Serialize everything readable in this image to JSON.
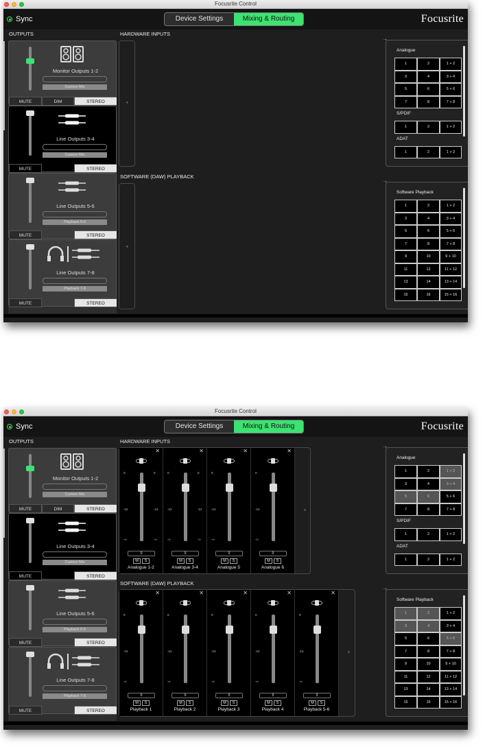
{
  "app": {
    "title": "Focusrite Control",
    "brand": "Focusrite"
  },
  "topbar": {
    "sync_label": "Sync",
    "tabs": [
      "Device Settings",
      "Mixing & Routing"
    ]
  },
  "sections": {
    "outputs": "OUTPUTS",
    "hardware_inputs": "HARDWARE INPUTS",
    "software_playback": "SOFTWARE (DAW) PLAYBACK"
  },
  "colors": {
    "accent": "#3ce370",
    "background": "#1e1e1e"
  },
  "outputs": [
    {
      "name": "Monitor Outputs 1-2",
      "source": "Custom Mix",
      "icon": "speakers-icon",
      "buttons": [
        "MUTE",
        "DIM",
        "STEREO"
      ]
    },
    {
      "name": "Line Outputs 3-4",
      "source": "Custom Mix",
      "icon": "line-cables-icon",
      "buttons": [
        "MUTE",
        "STEREO"
      ]
    },
    {
      "name": "Line Outputs 5-6",
      "source": "Playback 5-6",
      "icon": "line-cables-icon",
      "buttons": [
        "MUTE",
        "STEREO"
      ]
    },
    {
      "name": "Line Outputs 7-8",
      "source": "Playback 7-8",
      "icon": "headphones-icon",
      "buttons": [
        "MUTE",
        "STEREO"
      ]
    }
  ],
  "input_panel": {
    "groups": [
      {
        "title": "Analogue",
        "cells": [
          "1",
          "2",
          "1 + 2",
          "3",
          "4",
          "3 + 4",
          "5",
          "6",
          "5 + 6",
          "7",
          "8",
          "7 + 8"
        ]
      },
      {
        "title": "S/PDIF",
        "cells": [
          "1",
          "2",
          "1 + 2"
        ]
      },
      {
        "title": "ADAT",
        "cells": [
          "1",
          "2",
          "1 + 2"
        ]
      }
    ]
  },
  "playback_panel": {
    "title": "Software Playback",
    "cells": [
      "1",
      "2",
      "1 + 2",
      "3",
      "4",
      "3 + 4",
      "5",
      "6",
      "5 + 6",
      "7",
      "8",
      "7 + 8",
      "9",
      "10",
      "9 + 10",
      "11",
      "12",
      "11 + 12",
      "13",
      "14",
      "13 + 14",
      "15",
      "16",
      "15 + 16"
    ]
  },
  "mixer": {
    "close_glyph": "✕",
    "plus_glyph": "+",
    "scale": {
      "zero": "0",
      "minus12": "-12",
      "minus_inf": "-∞"
    },
    "mute_label": "M",
    "solo_label": "S",
    "gain_value": "0",
    "hardware_strips": [
      "Analogue 1-2",
      "Analogue 3-4",
      "Analogue 5",
      "Analogue 6"
    ],
    "playback_strips": [
      "Playback 1",
      "Playback 2",
      "Playback 3",
      "Playback 4",
      "Playback 5-6"
    ]
  }
}
